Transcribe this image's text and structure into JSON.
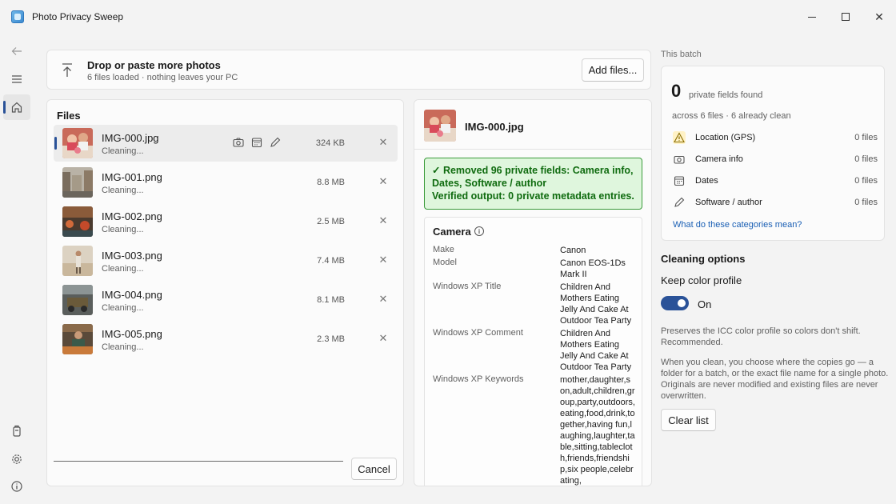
{
  "window": {
    "title": "Photo Privacy Sweep"
  },
  "drop": {
    "title": "Drop or paste more photos",
    "subtitle": "6 files loaded · nothing leaves your PC",
    "add_button": "Add files..."
  },
  "files": {
    "title": "Files",
    "items": [
      {
        "name": "IMG-000.jpg",
        "status": "Cleaning...",
        "size": "324 KB",
        "selected": true
      },
      {
        "name": "IMG-001.png",
        "status": "Cleaning...",
        "size": "8.8 MB"
      },
      {
        "name": "IMG-002.png",
        "status": "Cleaning...",
        "size": "2.5 MB"
      },
      {
        "name": "IMG-003.png",
        "status": "Cleaning...",
        "size": "7.4 MB"
      },
      {
        "name": "IMG-004.png",
        "status": "Cleaning...",
        "size": "8.1 MB"
      },
      {
        "name": "IMG-005.png",
        "status": "Cleaning...",
        "size": "2.3 MB"
      }
    ],
    "cancel_button": "Cancel"
  },
  "detail": {
    "file_name": "IMG-000.jpg",
    "success_line1": "✓ Removed 96 private fields: Camera info, Dates, Software / author",
    "success_line2": "Verified output: 0 private metadata entries.",
    "section_title": "Camera",
    "fields": [
      {
        "key": "Make",
        "value": "Canon"
      },
      {
        "key": "Model",
        "value": "Canon EOS-1Ds Mark II"
      },
      {
        "key": "Windows XP Title",
        "value": "Children And Mothers Eating Jelly And Cake At Outdoor Tea Party"
      },
      {
        "key": "Windows XP Comment",
        "value": "Children And Mothers Eating Jelly And Cake At Outdoor Tea Party"
      },
      {
        "key": "Windows XP Keywords",
        "value": "mother,daughter,son,adult,children,group,party,outdoors,eating,food,drink,together,having fun,laughing,laughter,table,sitting,tablecloth,friends,friendship,six people,celebrating,"
      }
    ]
  },
  "batch": {
    "label": "This batch",
    "count": "0",
    "count_label": "private fields found",
    "across": "across 6 files · 6 already clean",
    "categories": [
      {
        "label": "Location (GPS)",
        "count": "0 files",
        "icon": "warning-icon"
      },
      {
        "label": "Camera info",
        "count": "0 files",
        "icon": "camera-icon"
      },
      {
        "label": "Dates",
        "count": "0 files",
        "icon": "calendar-icon"
      },
      {
        "label": "Software / author",
        "count": "0 files",
        "icon": "pencil-icon"
      }
    ],
    "link": "What do these categories mean?"
  },
  "options": {
    "title": "Cleaning options",
    "keep_label": "Keep color profile",
    "toggle_state": "On",
    "toggle_on": true,
    "help1": "Preserves the ICC color profile so colors don't shift. Recommended.",
    "help2": "When you clean, you choose where the copies go — a folder for a batch, or the exact file name for a single photo. Originals are never modified and existing files are never overwritten.",
    "clear_button": "Clear list"
  },
  "colors": {
    "accent": "#2a5298",
    "success_bg": "#dff6dd",
    "success_border": "#3a9a3a",
    "link": "#1a5fb4"
  }
}
